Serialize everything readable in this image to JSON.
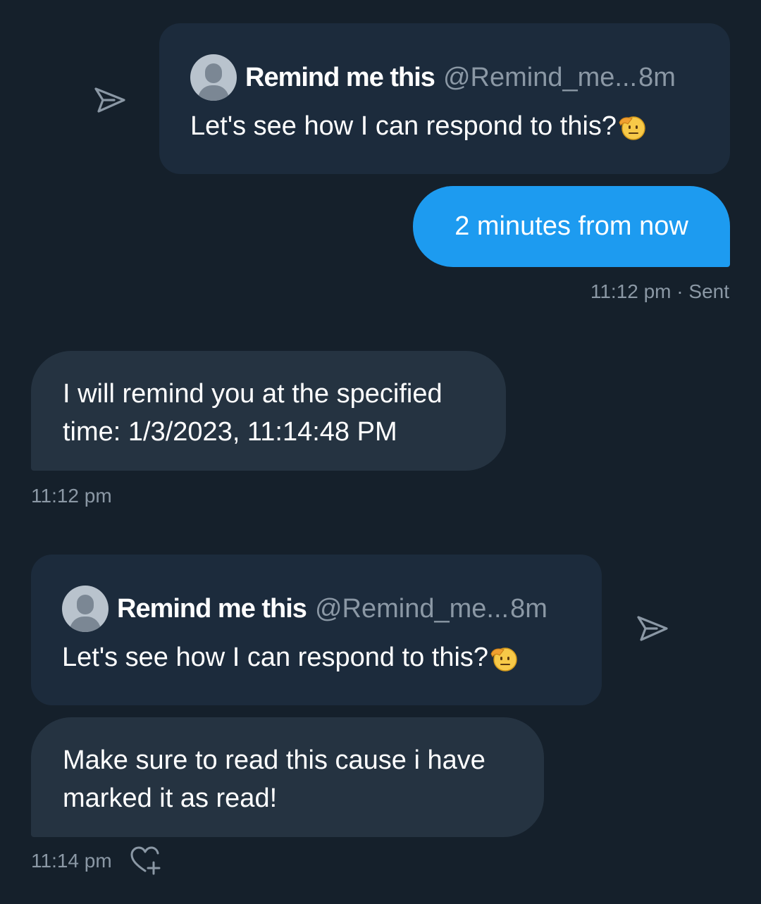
{
  "colors": {
    "background": "#15202b",
    "sent_bubble": "#1d9bf0",
    "received_bubble": "#253341",
    "quote_card": "#1c2b3c",
    "secondary_text": "#8b98a5"
  },
  "messages": [
    {
      "type": "quote",
      "direction": "outgoing",
      "quote": {
        "name": "Remind me this",
        "handle": "@Remind_me...",
        "age": "8m",
        "text": "Let's see how I can respond to this?",
        "emoji": "saluting-face"
      },
      "share_icon": "share-arrow-icon"
    },
    {
      "type": "text",
      "direction": "outgoing",
      "text": "2 minutes from now",
      "meta": "11:12 pm · Sent"
    },
    {
      "type": "text",
      "direction": "incoming",
      "lines": [
        "I will remind you at the specified",
        "time: 1/3/2023, 11:14:48 PM"
      ],
      "meta": "11:12 pm"
    },
    {
      "type": "quote",
      "direction": "incoming",
      "quote": {
        "name": "Remind me this",
        "handle": "@Remind_me...",
        "age": "8m",
        "text": "Let's see how I can respond to this?",
        "emoji": "saluting-face"
      },
      "share_icon": "share-arrow-icon"
    },
    {
      "type": "text",
      "direction": "incoming",
      "lines": [
        "Make sure to read this cause i have",
        "marked it as read!"
      ],
      "meta": "11:14 pm",
      "reaction_icon": "add-reaction-heart-icon"
    }
  ]
}
